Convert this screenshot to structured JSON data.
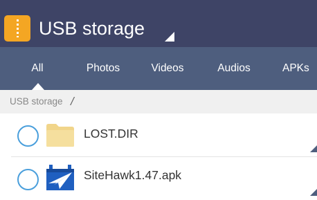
{
  "header": {
    "title": "USB storage"
  },
  "tabs": [
    {
      "label": "All",
      "selected": true
    },
    {
      "label": "Photos",
      "selected": false
    },
    {
      "label": "Videos",
      "selected": false
    },
    {
      "label": "Audios",
      "selected": false
    },
    {
      "label": "APKs",
      "selected": false
    }
  ],
  "breadcrumb": {
    "path": "USB storage",
    "separator": "/"
  },
  "files": [
    {
      "name": "LOST.DIR",
      "icon": "folder-icon",
      "checked": false
    },
    {
      "name": "SiteHawk1.47.apk",
      "icon": "apk-icon",
      "checked": false
    }
  ],
  "colors": {
    "titlebar": "#3e4466",
    "tabbar": "#4e5e7e",
    "accent": "#4a9fdc",
    "app_icon": "#f4a623",
    "folder": "#f1d58a"
  }
}
